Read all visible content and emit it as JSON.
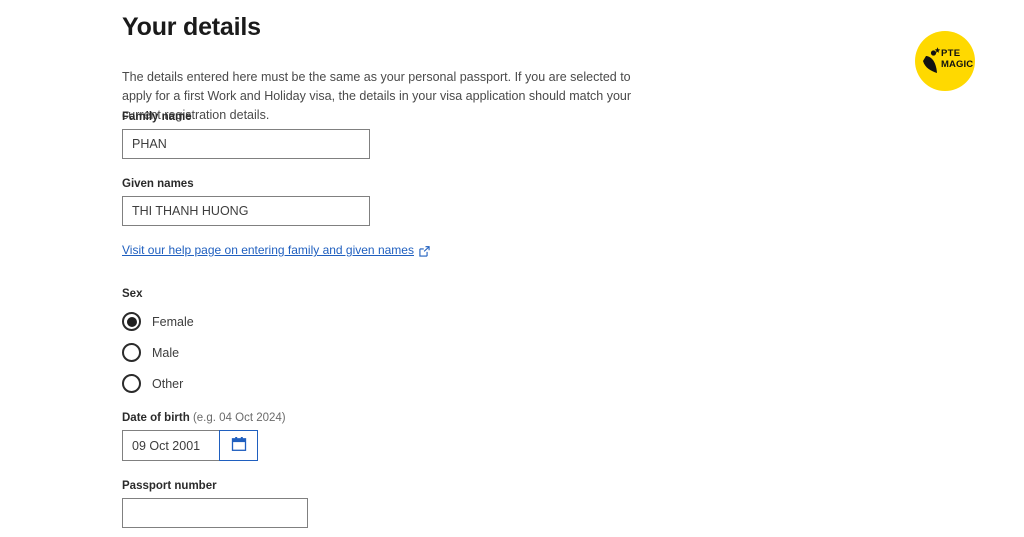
{
  "page": {
    "title": "Your details",
    "intro": "The details entered here must be the same as your personal passport. If you are selected to apply for a first Work and Holiday visa, the details in your visa application should match your current registration details."
  },
  "fields": {
    "family_name": {
      "label": "Family name",
      "value": "PHAN",
      "placeholder": ""
    },
    "given_names": {
      "label": "Given names",
      "value": "THI THANH HUONG",
      "placeholder": ""
    },
    "date_of_birth": {
      "label": "Date of birth",
      "hint": "(e.g. 04 Oct 2024)",
      "value": "09 Oct 2001",
      "placeholder": "",
      "calendar_icon": "calendar-icon"
    },
    "passport_number": {
      "label": "Passport number",
      "value": "",
      "placeholder": ""
    }
  },
  "help_link": {
    "text": "Visit our help page on entering family and given names",
    "icon": "external-link-icon"
  },
  "sex": {
    "label": "Sex",
    "selected": "Female",
    "options": [
      {
        "label": "Female",
        "selected": true
      },
      {
        "label": "Male",
        "selected": false
      },
      {
        "label": "Other",
        "selected": false
      }
    ]
  },
  "logo": {
    "line1": "PTE",
    "line2": "MAGIC",
    "background_color": "#ffd900",
    "mark": "person-star-mark"
  },
  "colors": {
    "link": "#1f5fbf",
    "accent": "#1f5fbf",
    "border": "#808080",
    "text": "#313131",
    "brand_yellow": "#ffd900"
  }
}
